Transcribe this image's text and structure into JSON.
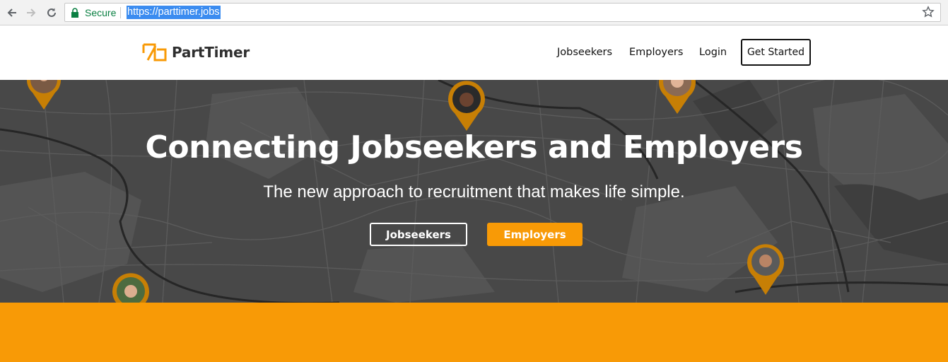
{
  "browser": {
    "secure_label": "Secure",
    "url": "https://parttimer.jobs",
    "icons": [
      "back-arrow-icon",
      "forward-arrow-icon",
      "reload-icon",
      "lock-icon",
      "star-icon"
    ]
  },
  "header": {
    "logo_text": "PartTimer",
    "nav": {
      "jobseekers": "Jobseekers",
      "employers": "Employers",
      "login": "Login",
      "get_started": "Get Started"
    }
  },
  "hero": {
    "title": "Connecting Jobseekers and Employers",
    "subtitle": "The new approach to recruitment that makes life simple.",
    "button_jobseekers": "Jobseekers",
    "button_employers": "Employers"
  },
  "colors": {
    "brand_orange": "#f89a06",
    "hero_background": "#4b4b4b",
    "secure_green": "#0b8043"
  }
}
